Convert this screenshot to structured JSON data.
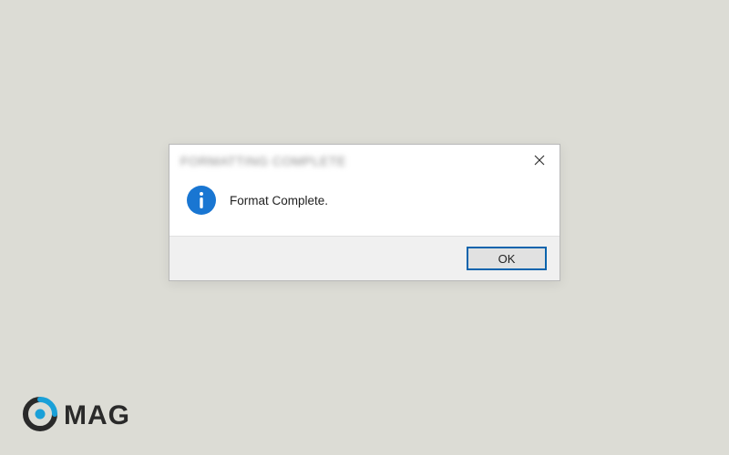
{
  "dialog": {
    "title": "FORMATTING COMPLETE",
    "message": "Format Complete.",
    "ok_label": "OK"
  },
  "watermark": {
    "text": "MAG"
  }
}
